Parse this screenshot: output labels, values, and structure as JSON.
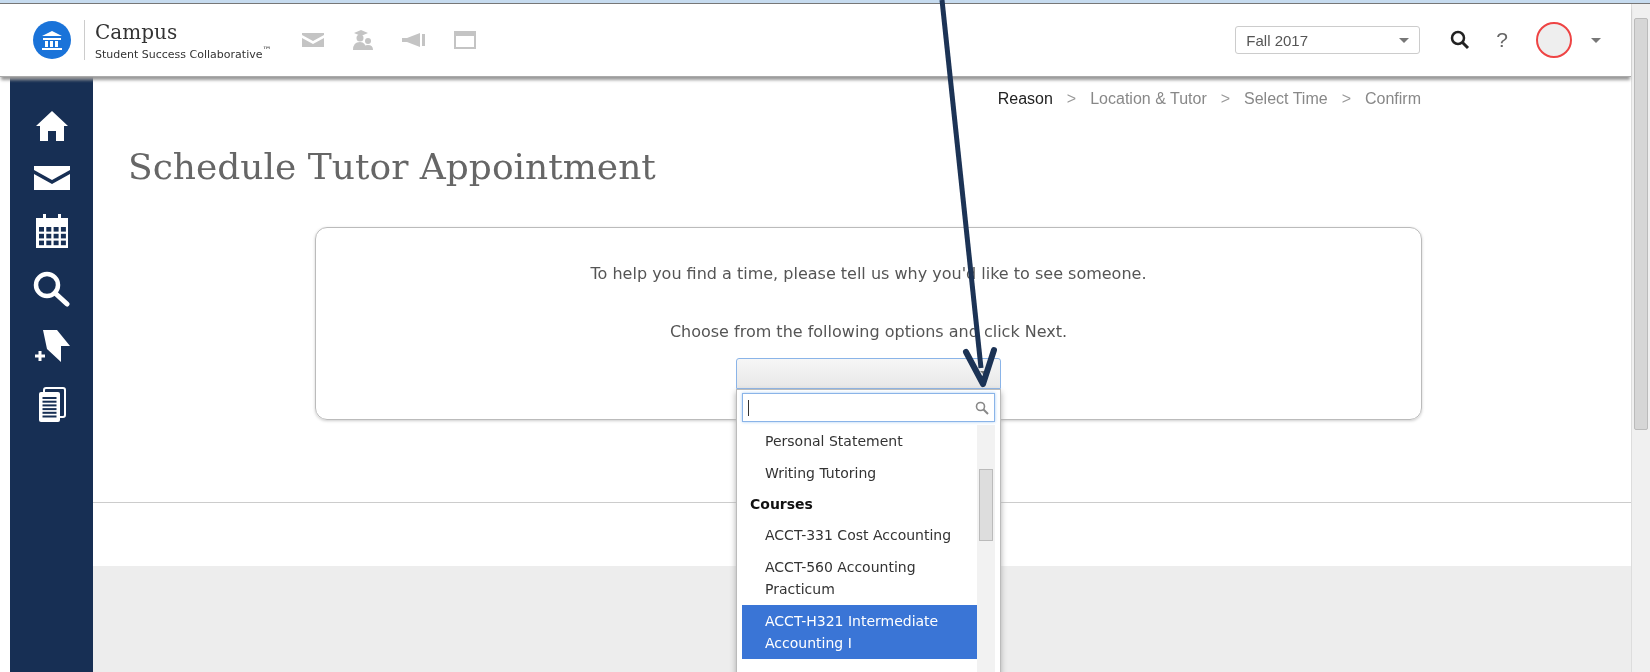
{
  "header": {
    "logo_title": "Campus",
    "logo_subtitle": "Student Success Collaborative$^{™}$",
    "tools": [
      {
        "kind": "mail"
      },
      {
        "kind": "people"
      },
      {
        "kind": "megaphone"
      },
      {
        "kind": "window"
      }
    ],
    "term_select": {
      "value": "Fall 2017"
    },
    "help": "?"
  },
  "sidebar": {
    "items": [
      {
        "kind": "home"
      },
      {
        "kind": "mail"
      },
      {
        "kind": "calendar"
      },
      {
        "kind": "search"
      },
      {
        "kind": "tag"
      },
      {
        "kind": "documents"
      }
    ]
  },
  "breadcrumb": [
    {
      "label": "Reason",
      "selected": true
    },
    {
      "separator": ">",
      "label": "Location & Tutor",
      "selected": false
    },
    {
      "separator": ">",
      "label": "Select Time",
      "selected": false
    },
    {
      "separator": ">",
      "label": "Confirm",
      "selected": false
    }
  ],
  "title": "Schedule Tutor Appointment",
  "card": {
    "lines": [
      "To help you find a time, please tell us why you'd like to see someone.",
      "Choose from the following options and click Next."
    ],
    "reason_select": {
      "open": true,
      "options": [
        {
          "kind": "option",
          "label": "Personal Statement",
          "selected": false
        },
        {
          "kind": "option",
          "label": "Writing Tutoring",
          "selected": false
        },
        {
          "kind": "group",
          "label": "Courses"
        },
        {
          "kind": "option",
          "label": "ACCT-331 Cost Accounting",
          "selected": false
        },
        {
          "kind": "option",
          "label": "ACCT-560 Accounting Practicum",
          "selected": false
        },
        {
          "kind": "option",
          "label": "ACCT-H321 Intermediate Accounting I",
          "selected": true
        }
      ]
    }
  }
}
